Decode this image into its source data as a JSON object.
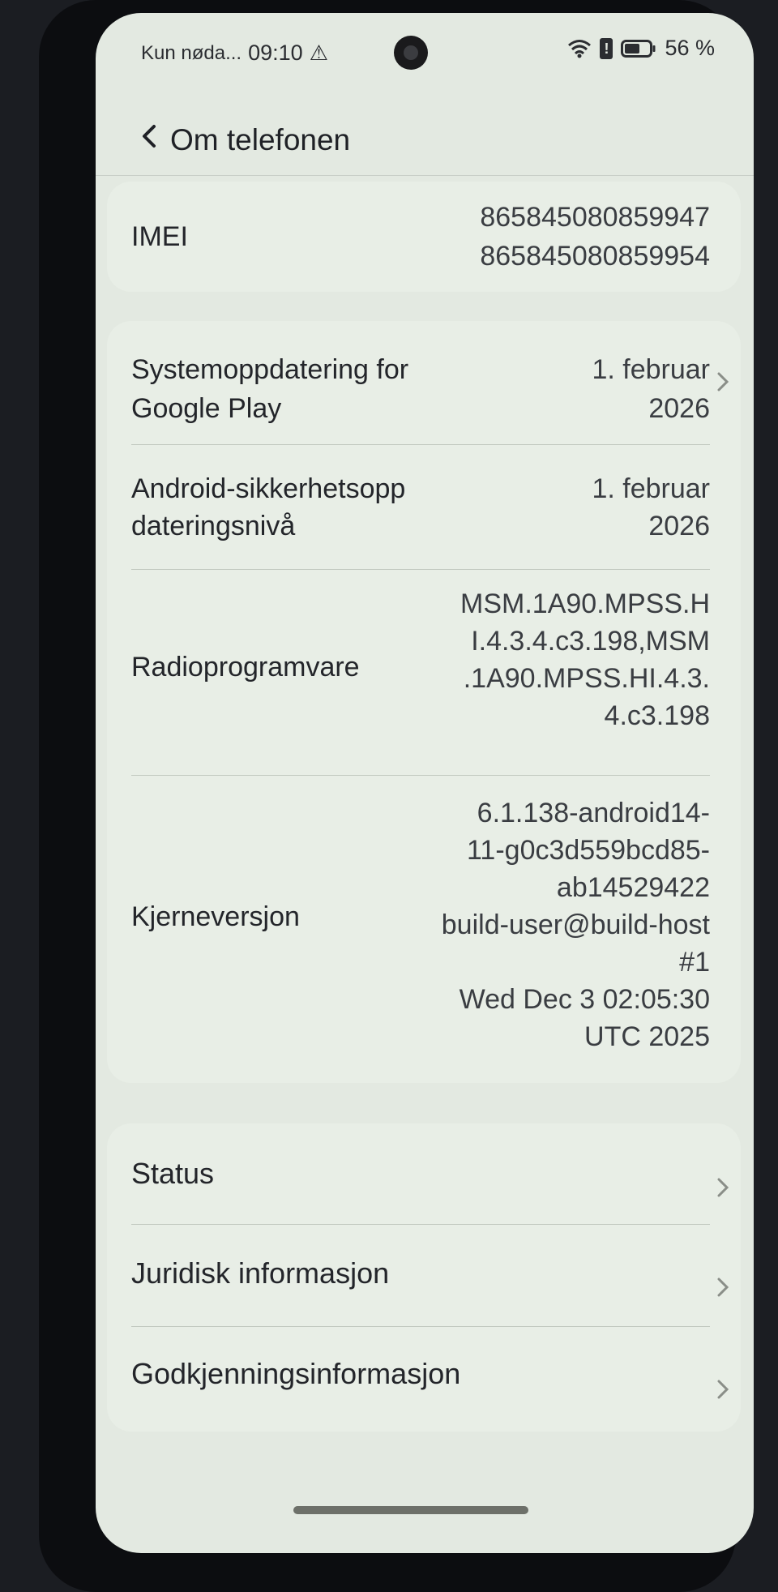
{
  "status_bar": {
    "carrier": "Kun nøda...",
    "time": "09:10",
    "battery_percent": "56 %",
    "icons": [
      "warning-icon",
      "wifi-icon",
      "alert-icon",
      "battery-icon"
    ]
  },
  "header": {
    "back_icon": "chevron-left-icon",
    "title": "Om telefonen"
  },
  "imei": {
    "label": "IMEI",
    "value_1": "865845080859947",
    "value_2": "865845080859954"
  },
  "info": {
    "play_update": {
      "label_1": "Systemoppdatering for",
      "label_2": "Google Play",
      "value_1": "1. februar",
      "value_2": "2026"
    },
    "security_patch": {
      "label_1": "Android-sikkerhetsopp",
      "label_2": "dateringsnivå",
      "value_1": "1. februar",
      "value_2": "2026"
    },
    "baseband": {
      "label": "Radioprogramvare",
      "lines": [
        "MSM.1A90.MPSS.H",
        "I.4.3.4.c3.198,MSM",
        ".1A90.MPSS.HI.4.3.",
        "4.c3.198"
      ]
    },
    "kernel": {
      "label": "Kjerneversjon",
      "lines": [
        "6.1.138-android14-",
        "11-g0c3d559bcd85-",
        "ab14529422",
        "build-user@build-host",
        "#1",
        "Wed Dec  3 02:05:30",
        "UTC 2025"
      ]
    }
  },
  "nav": {
    "status": "Status",
    "legal": "Juridisk informasjon",
    "approval": "Godkjenningsinformasjon"
  }
}
